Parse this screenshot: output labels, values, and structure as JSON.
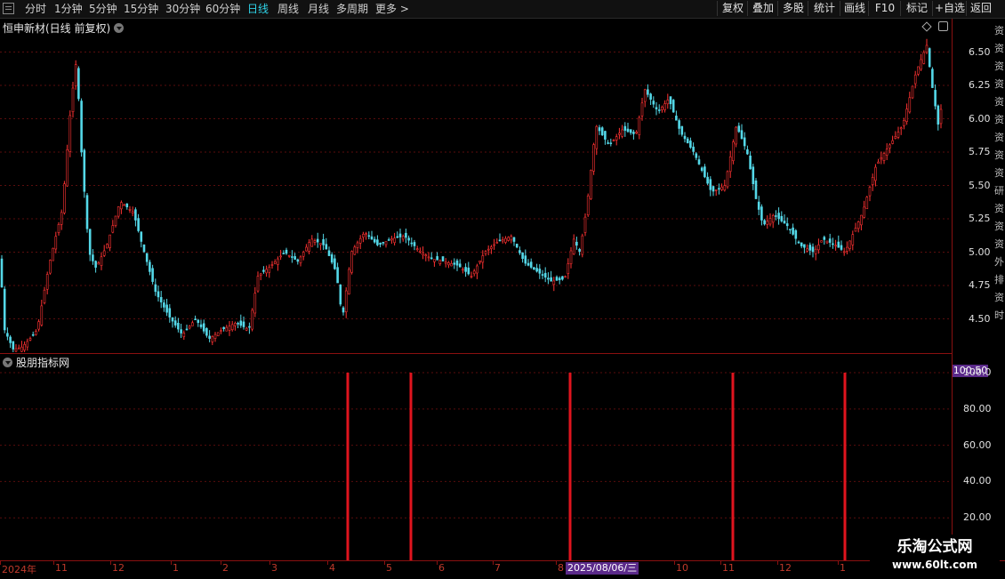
{
  "toolbar": {
    "left": [
      "分时",
      "1分钟",
      "5分钟",
      "15分钟",
      "30分钟",
      "60分钟",
      "日线",
      "周线",
      "月线",
      "多周期",
      "更多 >"
    ],
    "active": "日线",
    "right": [
      "复权",
      "叠加",
      "多股",
      "统计",
      "画线",
      "F10",
      "标记",
      "+自选",
      "返回"
    ]
  },
  "main": {
    "title": "恒申新材(日线 前复权)",
    "y_labels": [
      "6.50",
      "6.25",
      "6.00",
      "5.75",
      "5.50",
      "5.25",
      "5.00",
      "4.75",
      "4.50"
    ]
  },
  "indicator": {
    "title": "股朋指标网",
    "badge": "100.50",
    "y_labels": [
      "100.0",
      "80.00",
      "60.00",
      "40.00",
      "20.00"
    ]
  },
  "time_axis": {
    "labels": [
      "2024年",
      "11",
      "12",
      "1",
      "2",
      "3",
      "4",
      "5",
      "6",
      "7",
      "8",
      "10",
      "11",
      "12",
      "1"
    ],
    "crosshair_date": "2025/08/06/三"
  },
  "right_strip_text": "资资资资资资资资资研资资资外排资时",
  "watermark": {
    "line1": "乐淘公式网",
    "line2": "www.60lt.com"
  },
  "colors": {
    "up": "#ff3232",
    "down": "#54d8e8",
    "signal": "#e0141e",
    "grid": "#8a1010",
    "accent": "#5b2a8a"
  },
  "chart_data": {
    "type": "candlestick",
    "ylim": [
      4.25,
      6.75
    ],
    "close_path": [
      [
        0,
        4.95
      ],
      [
        5,
        4.42
      ],
      [
        15,
        4.27
      ],
      [
        25,
        4.29
      ],
      [
        35,
        4.36
      ],
      [
        42,
        4.42
      ],
      [
        55,
        4.9
      ],
      [
        70,
        5.32
      ],
      [
        80,
        6.12
      ],
      [
        86,
        6.45
      ],
      [
        92,
        5.7
      ],
      [
        100,
        5.0
      ],
      [
        108,
        4.88
      ],
      [
        120,
        5.05
      ],
      [
        135,
        5.38
      ],
      [
        150,
        5.3
      ],
      [
        160,
        5.05
      ],
      [
        175,
        4.7
      ],
      [
        190,
        4.52
      ],
      [
        205,
        4.38
      ],
      [
        220,
        4.5
      ],
      [
        235,
        4.35
      ],
      [
        250,
        4.42
      ],
      [
        265,
        4.47
      ],
      [
        280,
        4.42
      ],
      [
        290,
        4.82
      ],
      [
        305,
        4.9
      ],
      [
        320,
        5.0
      ],
      [
        335,
        4.93
      ],
      [
        350,
        5.1
      ],
      [
        365,
        5.05
      ],
      [
        378,
        4.85
      ],
      [
        385,
        4.5
      ],
      [
        395,
        5.0
      ],
      [
        410,
        5.15
      ],
      [
        425,
        5.05
      ],
      [
        440,
        5.1
      ],
      [
        455,
        5.12
      ],
      [
        470,
        5.02
      ],
      [
        485,
        4.95
      ],
      [
        500,
        4.93
      ],
      [
        515,
        4.9
      ],
      [
        530,
        4.82
      ],
      [
        545,
        5.0
      ],
      [
        560,
        5.08
      ],
      [
        575,
        5.12
      ],
      [
        590,
        4.92
      ],
      [
        605,
        4.85
      ],
      [
        620,
        4.78
      ],
      [
        635,
        4.8
      ],
      [
        645,
        5.1
      ],
      [
        652,
        5.0
      ],
      [
        660,
        5.35
      ],
      [
        670,
        5.95
      ],
      [
        685,
        5.8
      ],
      [
        700,
        5.92
      ],
      [
        715,
        5.88
      ],
      [
        725,
        6.22
      ],
      [
        740,
        6.05
      ],
      [
        752,
        6.15
      ],
      [
        765,
        5.9
      ],
      [
        780,
        5.75
      ],
      [
        790,
        5.6
      ],
      [
        800,
        5.45
      ],
      [
        815,
        5.5
      ],
      [
        828,
        5.95
      ],
      [
        840,
        5.75
      ],
      [
        850,
        5.4
      ],
      [
        858,
        5.2
      ],
      [
        870,
        5.28
      ],
      [
        885,
        5.2
      ],
      [
        900,
        5.05
      ],
      [
        915,
        5.0
      ],
      [
        925,
        5.1
      ],
      [
        940,
        5.05
      ],
      [
        950,
        5.0
      ],
      [
        960,
        5.15
      ],
      [
        970,
        5.3
      ],
      [
        985,
        5.65
      ],
      [
        1000,
        5.8
      ],
      [
        1015,
        5.95
      ],
      [
        1030,
        6.35
      ],
      [
        1042,
        6.55
      ],
      [
        1048,
        6.25
      ],
      [
        1055,
        5.95
      ],
      [
        1060,
        6.15
      ]
    ],
    "signals": {
      "type": "bar",
      "positions": [
        391,
        462,
        641,
        824,
        950
      ],
      "value": 100.0,
      "ylim": [
        0,
        100.5
      ]
    }
  }
}
